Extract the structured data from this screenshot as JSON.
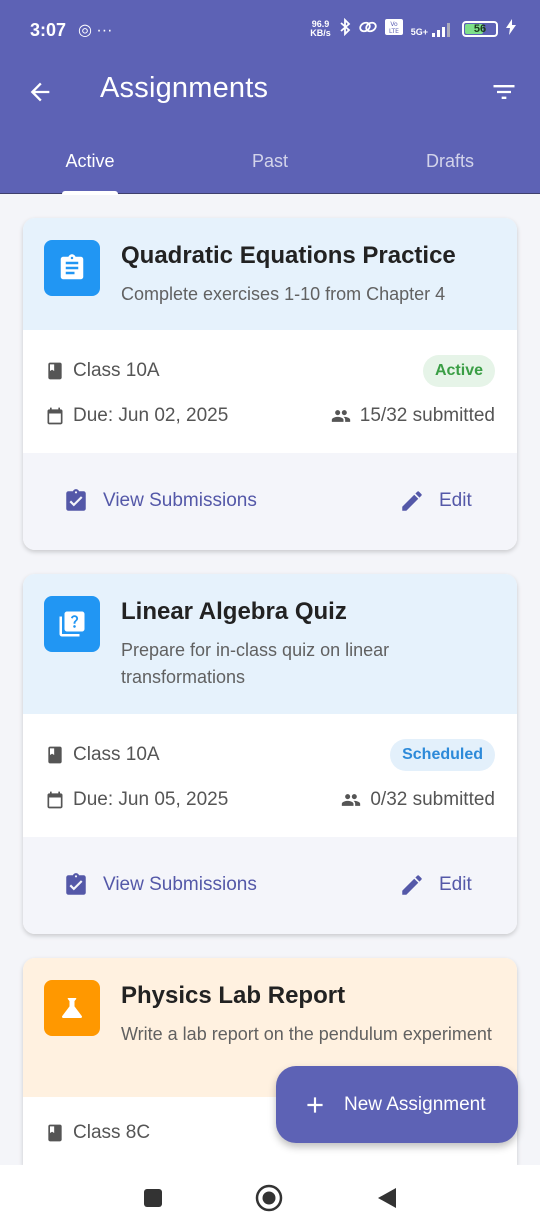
{
  "status_bar": {
    "time": "3:07",
    "left_icons": "◎ ···",
    "net_speed_value": "96.9",
    "net_speed_unit": "KB/s",
    "network": "5G+",
    "battery": "56",
    "battery_level": 0.56
  },
  "app_bar": {
    "title": "Assignments"
  },
  "tabs": [
    {
      "label": "Active",
      "selected": true
    },
    {
      "label": "Past",
      "selected": false
    },
    {
      "label": "Drafts",
      "selected": false
    }
  ],
  "assignments": [
    {
      "icon": "clipboard-icon",
      "title": "Quadratic Equations Practice",
      "description": "Complete exercises 1-10 from Chapter 4",
      "class": "Class 10A",
      "status": "Active",
      "due": "Due: Jun 02, 2025",
      "submitted": "15/32 submitted",
      "view_label": "View Submissions",
      "edit_label": "Edit"
    },
    {
      "icon": "quiz-icon",
      "title": "Linear Algebra Quiz",
      "description": "Prepare for in-class quiz on linear transformations",
      "class": "Class 10A",
      "status": "Scheduled",
      "due": "Due: Jun 05, 2025",
      "submitted": "0/32 submitted",
      "view_label": "View Submissions",
      "edit_label": "Edit"
    },
    {
      "icon": "flask-icon",
      "title": "Physics Lab Report",
      "description": "Write a lab report on the pendulum experiment",
      "class": "Class 8C"
    }
  ],
  "fab": {
    "label": "New Assignment"
  },
  "colors": {
    "primary": "#5d62b5",
    "blue_accent": "#2196f3",
    "orange_accent": "#ff9800",
    "active_badge": "#3a9e45",
    "scheduled_badge": "#2d8ad9"
  }
}
